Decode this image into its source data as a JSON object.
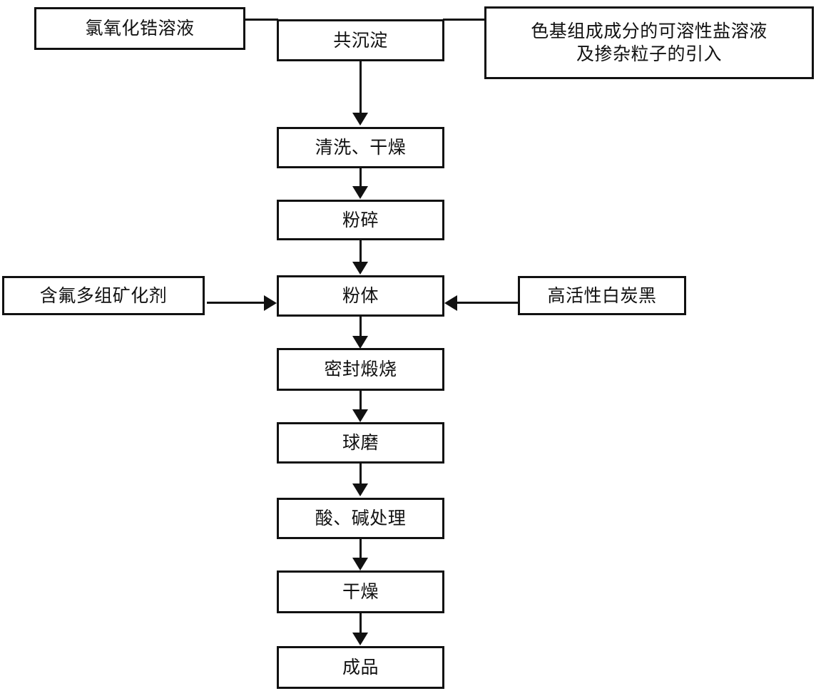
{
  "diagram": {
    "type": "process-flowchart",
    "orientation": "top-to-bottom",
    "language": "zh-CN",
    "colors": {
      "stroke": "#111111",
      "fill": "#ffffff",
      "text": "#111111"
    },
    "nodes": [
      {
        "id": "zirconium-oxychloride-solution",
        "label": "氯氧化锆溶液",
        "role": "input-material",
        "column": "left"
      },
      {
        "id": "coprecipitation",
        "label": "共沉淀",
        "role": "process",
        "column": "center",
        "step": 1
      },
      {
        "id": "soluble-salt-and-doping-particles",
        "label": "色基组成成分的可溶性盐溶液\n及掺杂粒子的引入",
        "role": "input-material",
        "column": "right"
      },
      {
        "id": "wash-dry",
        "label": "清洗、干燥",
        "role": "process",
        "column": "center",
        "step": 2
      },
      {
        "id": "crush",
        "label": "粉碎",
        "role": "process",
        "column": "center",
        "step": 3
      },
      {
        "id": "fluorine-mineralizer",
        "label": "含氟多组矿化剂",
        "role": "input-material",
        "column": "left"
      },
      {
        "id": "powder",
        "label": "粉体",
        "role": "process",
        "column": "center",
        "step": 4
      },
      {
        "id": "high-activity-white-carbon-black",
        "label": "高活性白炭黑",
        "role": "input-material",
        "column": "right"
      },
      {
        "id": "sealed-calcination",
        "label": "密封煅烧",
        "role": "process",
        "column": "center",
        "step": 5
      },
      {
        "id": "ball-milling",
        "label": "球磨",
        "role": "process",
        "column": "center",
        "step": 6
      },
      {
        "id": "acid-alkali-treatment",
        "label": "酸、碱处理",
        "role": "process",
        "column": "center",
        "step": 7
      },
      {
        "id": "drying",
        "label": "干燥",
        "role": "process",
        "column": "center",
        "step": 8
      },
      {
        "id": "finished-product",
        "label": "成品",
        "role": "output",
        "column": "center",
        "step": 9
      }
    ],
    "edges": [
      {
        "from": "zirconium-oxychloride-solution",
        "to": "coprecipitation",
        "style": "elbow-no-head"
      },
      {
        "from": "soluble-salt-and-doping-particles",
        "to": "coprecipitation",
        "style": "elbow-no-head"
      },
      {
        "from": "coprecipitation",
        "to": "wash-dry",
        "style": "arrow-down"
      },
      {
        "from": "wash-dry",
        "to": "crush",
        "style": "arrow-down"
      },
      {
        "from": "crush",
        "to": "powder",
        "style": "arrow-down"
      },
      {
        "from": "fluorine-mineralizer",
        "to": "powder",
        "style": "arrow-right"
      },
      {
        "from": "high-activity-white-carbon-black",
        "to": "powder",
        "style": "arrow-left"
      },
      {
        "from": "powder",
        "to": "sealed-calcination",
        "style": "arrow-down"
      },
      {
        "from": "sealed-calcination",
        "to": "ball-milling",
        "style": "arrow-down"
      },
      {
        "from": "ball-milling",
        "to": "acid-alkali-treatment",
        "style": "arrow-down"
      },
      {
        "from": "acid-alkali-treatment",
        "to": "drying",
        "style": "arrow-down"
      },
      {
        "from": "drying",
        "to": "finished-product",
        "style": "arrow-down"
      }
    ]
  }
}
